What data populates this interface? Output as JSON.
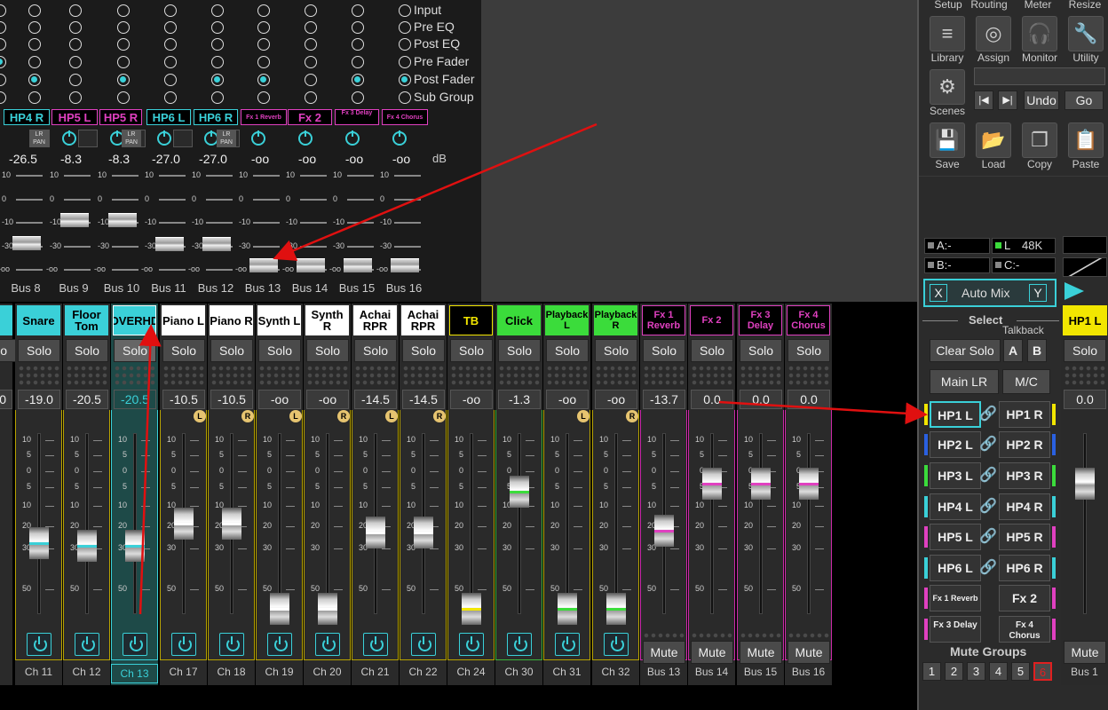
{
  "taps": [
    "Input",
    "Pre EQ",
    "Post EQ",
    "Pre Fader",
    "Post Fader",
    "Sub Group"
  ],
  "busStrips": [
    {
      "name": "HP4 R",
      "color": "#3ad0d8",
      "level": "-26.5",
      "label": "Bus 8",
      "fader": -26.5
    },
    {
      "name": "HP5 L",
      "color": "#e040c0",
      "level": "-8.3",
      "label": "Bus 9",
      "fader": -8.3
    },
    {
      "name": "HP5 R",
      "color": "#e040c0",
      "level": "-8.3",
      "label": "Bus 10",
      "fader": -8.3
    },
    {
      "name": "HP6 L",
      "color": "#3ad0d8",
      "level": "-27.0",
      "label": "Bus 11",
      "fader": -27.0
    },
    {
      "name": "HP6 R",
      "color": "#3ad0d8",
      "level": "-27.0",
      "label": "Bus 12",
      "fader": -27.0
    },
    {
      "name": "Fx 1 Reverb",
      "color": "#e040c0",
      "level": "-oo",
      "label": "Bus 13",
      "fader": -60
    },
    {
      "name": "Fx 2",
      "color": "#e040c0",
      "level": "-oo",
      "label": "Bus 14",
      "fader": -60
    },
    {
      "name": "Fx 3 Delay",
      "color": "#e040c0",
      "level": "-oo",
      "label": "Bus 15",
      "fader": -60
    },
    {
      "name": "Fx 4 Chorus",
      "color": "#e040c0",
      "level": "-oo",
      "label": "Bus 16",
      "fader": -60
    }
  ],
  "dbUnit": "dB",
  "busScale": [
    "10",
    "0",
    "-10",
    "-30",
    "-oo"
  ],
  "lrPan": "LR PAN",
  "solo": "Solo",
  "mute": "Mute",
  "channels": [
    {
      "name": "Snare",
      "bg": "#3ad0d8",
      "fg": "#000",
      "level": "-19.0",
      "label": "Ch 11",
      "fader": -19,
      "accent": "#3ad0d8",
      "border": "y"
    },
    {
      "name": "Floor Tom",
      "bg": "#3ad0d8",
      "fg": "#000",
      "level": "-20.5",
      "label": "Ch 12",
      "fader": -20.5,
      "accent": "#3ad0d8",
      "border": "y"
    },
    {
      "name": "OVERHD",
      "bg": "#3ad0d8",
      "fg": "#000",
      "level": "-20.5",
      "label": "Ch 13",
      "fader": -20.5,
      "accent": "#3ad0d8",
      "border": "y",
      "selected": true
    },
    {
      "name": "Piano L",
      "bg": "#fff",
      "fg": "#000",
      "level": "-10.5",
      "label": "Ch 17",
      "fader": -10.5,
      "accent": "#fff",
      "border": "y",
      "lr": "L"
    },
    {
      "name": "Piano R",
      "bg": "#fff",
      "fg": "#000",
      "level": "-10.5",
      "label": "Ch 18",
      "fader": -10.5,
      "accent": "#fff",
      "border": "y",
      "lr": "R"
    },
    {
      "name": "Synth L",
      "bg": "#fff",
      "fg": "#000",
      "level": "-oo",
      "label": "Ch 19",
      "fader": -60,
      "accent": "#fff",
      "border": "y",
      "lr": "L"
    },
    {
      "name": "Synth R",
      "bg": "#fff",
      "fg": "#000",
      "level": "-oo",
      "label": "Ch 20",
      "fader": -60,
      "accent": "#fff",
      "border": "y",
      "lr": "R"
    },
    {
      "name": "Achai RPR",
      "bg": "#fff",
      "fg": "#000",
      "level": "-14.5",
      "label": "Ch 21",
      "fader": -14.5,
      "accent": "#fff",
      "border": "y",
      "lr": "L"
    },
    {
      "name": "Achai RPR",
      "bg": "#fff",
      "fg": "#000",
      "level": "-14.5",
      "label": "Ch 22",
      "fader": -14.5,
      "accent": "#fff",
      "border": "y",
      "lr": "R"
    },
    {
      "name": "TB",
      "bg": "#000",
      "fg": "#f2e600",
      "level": "-oo",
      "label": "Ch 24",
      "fader": -60,
      "accent": "#f2e600",
      "border": "y",
      "outline": "#f2e600"
    },
    {
      "name": "Click",
      "bg": "#3bdc3b",
      "fg": "#000",
      "level": "-1.3",
      "label": "Ch 30",
      "fader": -1.3,
      "accent": "#3bdc3b",
      "border": "g"
    },
    {
      "name": "Playback L",
      "bg": "#3bdc3b",
      "fg": "#000",
      "level": "-oo",
      "label": "Ch 31",
      "fader": -60,
      "accent": "#3bdc3b",
      "border": "y",
      "lr": "L",
      "small": true
    },
    {
      "name": "Playback R",
      "bg": "#3bdc3b",
      "fg": "#000",
      "level": "-oo",
      "label": "Ch 32",
      "fader": -60,
      "accent": "#3bdc3b",
      "border": "y",
      "lr": "R",
      "small": true
    },
    {
      "name": "Fx 1 Reverb",
      "bg": "#000",
      "fg": "#e040c0",
      "level": "-13.7",
      "label": "Bus 13",
      "fader": -13.7,
      "accent": "#e040c0",
      "border": "m",
      "fx": true,
      "outline": "#e040c0"
    },
    {
      "name": "Fx 2",
      "bg": "#000",
      "fg": "#e040c0",
      "level": "0.0",
      "label": "Bus 14",
      "fader": 0,
      "accent": "#e040c0",
      "border": "m",
      "fx": true,
      "outline": "#e040c0"
    },
    {
      "name": "Fx 3 Delay",
      "bg": "#000",
      "fg": "#e040c0",
      "level": "0.0",
      "label": "Bus 15",
      "fader": 0,
      "accent": "#e040c0",
      "border": "m",
      "fx": true,
      "outline": "#e040c0"
    },
    {
      "name": "Fx 4 Chorus",
      "bg": "#000",
      "fg": "#e040c0",
      "level": "0.0",
      "label": "Bus 16",
      "fader": 0,
      "accent": "#e040c0",
      "border": "m",
      "fx": true,
      "outline": "#e040c0"
    }
  ],
  "chScale": [
    "10",
    "5",
    "0",
    "5",
    "10",
    "20",
    "30",
    "50"
  ],
  "leftEdge": {
    "level": "0",
    "label": "0"
  },
  "menu": [
    "Setup",
    "Routing",
    "Meter",
    "Resize"
  ],
  "tools": [
    {
      "label": "Library",
      "icon": "≡"
    },
    {
      "label": "Assign",
      "icon": "◎"
    },
    {
      "label": "Monitor",
      "icon": "🎧"
    },
    {
      "label": "Utility",
      "icon": "🔧"
    },
    {
      "label": "Scenes",
      "icon": "⚙"
    },
    {
      "label": "Save",
      "icon": "💾"
    },
    {
      "label": "Load",
      "icon": "📂"
    },
    {
      "label": "Copy",
      "icon": "❐"
    },
    {
      "label": "Paste",
      "icon": "📋"
    }
  ],
  "nav": {
    "prev": "|◀",
    "next": "▶|",
    "undo": "Undo",
    "go": "Go"
  },
  "info": {
    "a": "A:-",
    "l": "L",
    "rate": "48K",
    "b": "B:-",
    "c": "C:-"
  },
  "automix": {
    "x": "X",
    "label": "Auto Mix",
    "y": "Y"
  },
  "select": "Select",
  "talkback": "Talkback",
  "clearSolo": "Clear Solo",
  "tbA": "A",
  "tbB": "B",
  "mainLR": "Main LR",
  "mc": "M/C",
  "hp": [
    {
      "l": "HP1 L",
      "r": "HP1 R",
      "c": "#f2e600"
    },
    {
      "l": "HP2 L",
      "r": "HP2 R",
      "c": "#2a60e0"
    },
    {
      "l": "HP3 L",
      "r": "HP3 R",
      "c": "#3bdc3b"
    },
    {
      "l": "HP4 L",
      "r": "HP4 R",
      "c": "#3ad0d8"
    },
    {
      "l": "HP5 L",
      "r": "HP5 R",
      "c": "#e040c0"
    },
    {
      "l": "HP6 L",
      "r": "HP6 R",
      "c": "#3ad0d8"
    }
  ],
  "fxSel": [
    "Fx 1 Reverb",
    "Fx 2",
    "Fx 3 Delay",
    "Fx 4 Chorus"
  ],
  "muteGroups": {
    "title": "Mute Groups",
    "items": [
      "1",
      "2",
      "3",
      "4",
      "5",
      "6"
    ]
  },
  "rightStrip": {
    "name": "HP1 L",
    "level": "0.0",
    "label": "Bus 1",
    "fader": 0
  }
}
